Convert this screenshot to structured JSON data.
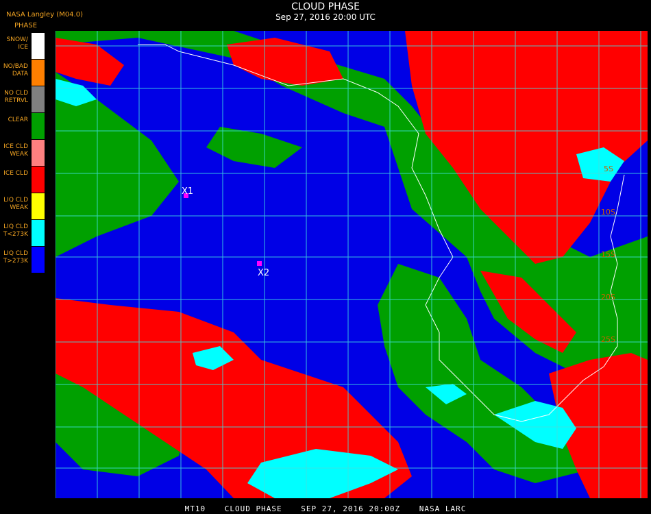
{
  "header": {
    "source": "NASA Langley (M04.0)",
    "legend_title": "PHASE",
    "title": "CLOUD PHASE",
    "datetime": "Sep 27, 2016 20:00 UTC"
  },
  "legend": [
    {
      "label": "SNOW/\nICE",
      "color": "#ffffff"
    },
    {
      "label": "NO/BAD\nDATA",
      "color": "#ff7f00"
    },
    {
      "label": "NO CLD\nRETRVL",
      "color": "#808080"
    },
    {
      "label": "CLEAR",
      "color": "#00a000"
    },
    {
      "label": "ICE CLD\nWEAK",
      "color": "#ff8080"
    },
    {
      "label": "ICE CLD",
      "color": "#ff0000"
    },
    {
      "label": "LIQ CLD\nWEAK",
      "color": "#ffff00"
    },
    {
      "label": "LIQ CLD\nT<273K",
      "color": "#00ffff"
    },
    {
      "label": "LIQ CLD\nT>273K",
      "color": "#0000ff"
    }
  ],
  "markers": [
    {
      "label": "X1",
      "color": "#ff00ff"
    },
    {
      "label": "X2",
      "color": "#ff00ff"
    }
  ],
  "lat_labels": [
    "5S",
    "10S",
    "15S",
    "20S",
    "25S"
  ],
  "footer": {
    "product": "MT10",
    "name": "CLOUD PHASE",
    "date": "SEP 27, 2016 20:00Z",
    "org": "NASA LARC"
  },
  "colors": {
    "grid": "#40e0e0",
    "coast": "#ffffff",
    "ocean_liquid": "#0000e6",
    "clear": "#00a000",
    "ice": "#ff0000",
    "liquid_cold": "#00ffff"
  }
}
